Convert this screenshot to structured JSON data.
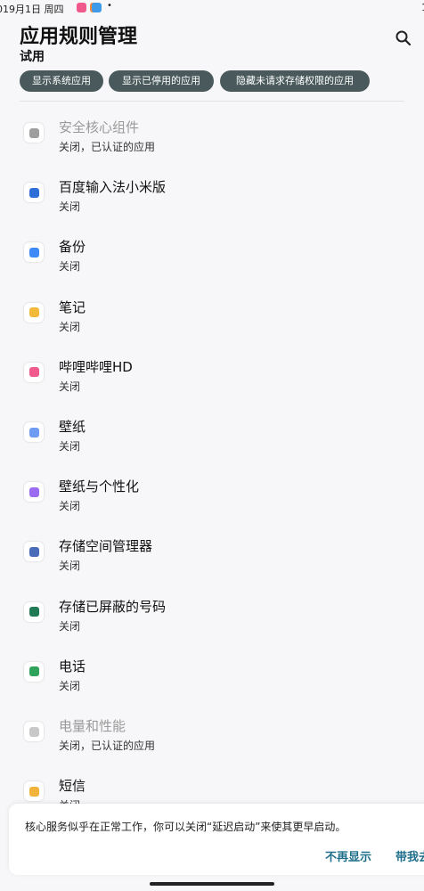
{
  "status_bar": {
    "time_text": "019月1日 周四",
    "right_text": "1",
    "dot": "•",
    "notification_icons": [
      "bilibili-notif-icon",
      "orange-app-notif-icon",
      "cloud-notif-icon"
    ]
  },
  "header": {
    "title": "应用规则管理",
    "subtitle": "试用"
  },
  "chips": [
    {
      "label": "显示系统应用"
    },
    {
      "label": "显示已停用的应用"
    },
    {
      "label": "隐藏未请求存储权限的应用"
    }
  ],
  "apps": [
    {
      "name": "安全核心组件",
      "status": "关闭，已认证的应用",
      "disabled": true,
      "icon": "security-component-icon",
      "icon_color": "#9e9e9e"
    },
    {
      "name": "百度输入法小米版",
      "status": "关闭",
      "disabled": false,
      "icon": "baidu-ime-icon",
      "icon_color": "#2d6fd6"
    },
    {
      "name": "备份",
      "status": "关闭",
      "disabled": false,
      "icon": "backup-icon",
      "icon_color": "#3d8af7"
    },
    {
      "name": "笔记",
      "status": "关闭",
      "disabled": false,
      "icon": "notes-icon",
      "icon_color": "#f3b93b"
    },
    {
      "name": "哔哩哔哩HD",
      "status": "关闭",
      "disabled": false,
      "icon": "bilibili-hd-icon",
      "icon_color": "#f0598b"
    },
    {
      "name": "壁纸",
      "status": "关闭",
      "disabled": false,
      "icon": "wallpaper-icon",
      "icon_color": "#6f9bf2"
    },
    {
      "name": "壁纸与个性化",
      "status": "关闭",
      "disabled": false,
      "icon": "themes-icon",
      "icon_color": "#9b6cf2"
    },
    {
      "name": "存储空间管理器",
      "status": "关闭",
      "disabled": false,
      "icon": "storage-manager-icon",
      "icon_color": "#4a6cb8"
    },
    {
      "name": "存储已屏蔽的号码",
      "status": "关闭",
      "disabled": false,
      "icon": "blocked-numbers-icon",
      "icon_color": "#1f7a55"
    },
    {
      "name": "电话",
      "status": "关闭",
      "disabled": false,
      "icon": "phone-icon",
      "icon_color": "#2fa35a"
    },
    {
      "name": "电量和性能",
      "status": "关闭，已认证的应用",
      "disabled": true,
      "icon": "battery-icon",
      "icon_color": "#c8c8c8"
    },
    {
      "name": "短信",
      "status": "关闭",
      "disabled": false,
      "icon": "sms-icon",
      "icon_color": "#f2b33d"
    }
  ],
  "toast": {
    "message": "核心服务似乎在正常工作，你可以关闭“延迟启动”来使其更早启动。",
    "dismiss_label": "不再显示",
    "action_label": "带我去"
  }
}
